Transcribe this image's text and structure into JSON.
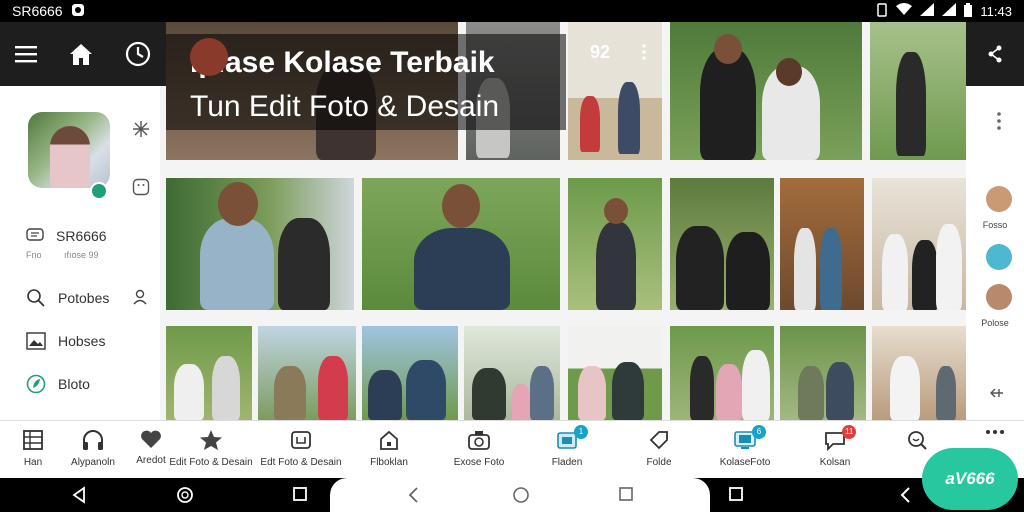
{
  "status_bar": {
    "carrier": "SR6666",
    "time": "11:43"
  },
  "header": {
    "overlay_title_line1": "Iplase Kolase Terbaik",
    "overlay_title_line2": "Tun Edit Foto & Desain",
    "tile_badge": "92"
  },
  "left_panel": {
    "profile_name": "SR6666",
    "profile_sub_left": "Fno",
    "profile_sub_right": "ıfıose 99",
    "items": [
      {
        "label": "Potobes",
        "icon": "search-icon"
      },
      {
        "label": "Hobses",
        "icon": "image-icon"
      },
      {
        "label": "Bloto",
        "icon": "leaf-icon"
      }
    ]
  },
  "right_panel": {
    "avatars": [
      {
        "label": "Fosso",
        "color": "#c99a73"
      },
      {
        "label": "",
        "color": "#4db8d0"
      },
      {
        "label": "Polose",
        "color": "#b8896a"
      }
    ]
  },
  "bottom_nav": [
    {
      "label": "Han",
      "icon": "grid-icon"
    },
    {
      "label": "Alypanoln",
      "icon": "headphones-icon"
    },
    {
      "label": "Aredot",
      "icon": "heart-icon"
    },
    {
      "label": "Edit Foto & Desain",
      "icon": "star-icon"
    },
    {
      "label": "Edt Foto & Desain",
      "icon": "frame-icon"
    },
    {
      "label": "Flboklan",
      "icon": "home-icon"
    },
    {
      "label": "Exose Foto",
      "icon": "camera-icon"
    },
    {
      "label": "Fladen",
      "icon": "gallery-icon",
      "badge": "1"
    },
    {
      "label": "Folde",
      "icon": "tag-icon"
    },
    {
      "label": "KolaseFoto",
      "icon": "monitor-icon",
      "badge": "6"
    },
    {
      "label": "Kolsan",
      "icon": "chat-icon",
      "badge": "11"
    },
    {
      "label": "",
      "icon": "search-icon"
    },
    {
      "label": "",
      "icon": "more-icon"
    }
  ],
  "fab": {
    "label": "aV666"
  },
  "colors": {
    "accent": "#27c8a0",
    "appbar": "#1e1e1e",
    "badge_blue": "#18a2c8",
    "badge_red": "#e23b3b"
  }
}
